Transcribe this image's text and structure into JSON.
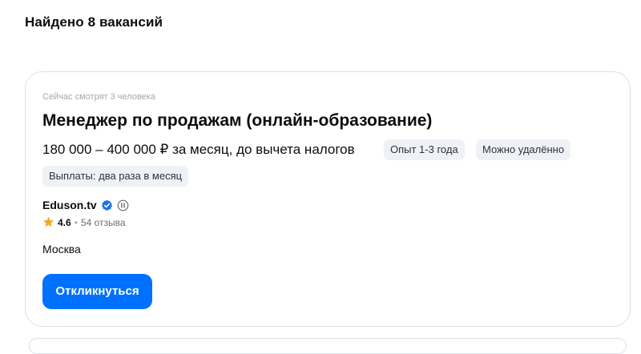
{
  "results": {
    "count_text": "Найдено 8 вакансий"
  },
  "vacancy": {
    "viewers_text": "Сейчас смотрят 3 человека",
    "title": "Менеджер по продажам (онлайн-образование)",
    "salary": "180 000 – 400 000 ₽ за месяц, до вычета налогов",
    "tags": {
      "experience": "Опыт 1-3 года",
      "remote": "Можно удалённо",
      "payouts": "Выплаты: два раза в месяц"
    },
    "company": {
      "name": "Eduson.tv",
      "rating": "4.6",
      "separator": "•",
      "reviews": "54 отзыва",
      "icons": [
        "verified-badge-icon",
        "trusted-employer-icon",
        "star-icon"
      ]
    },
    "location": "Москва",
    "apply_label": "Откликнуться"
  },
  "colors": {
    "accent": "#0070ff",
    "verified": "#1a73e8",
    "star": "#f5a623",
    "chip_bg": "#eef1f5",
    "muted_text": "#a3a8ae"
  }
}
